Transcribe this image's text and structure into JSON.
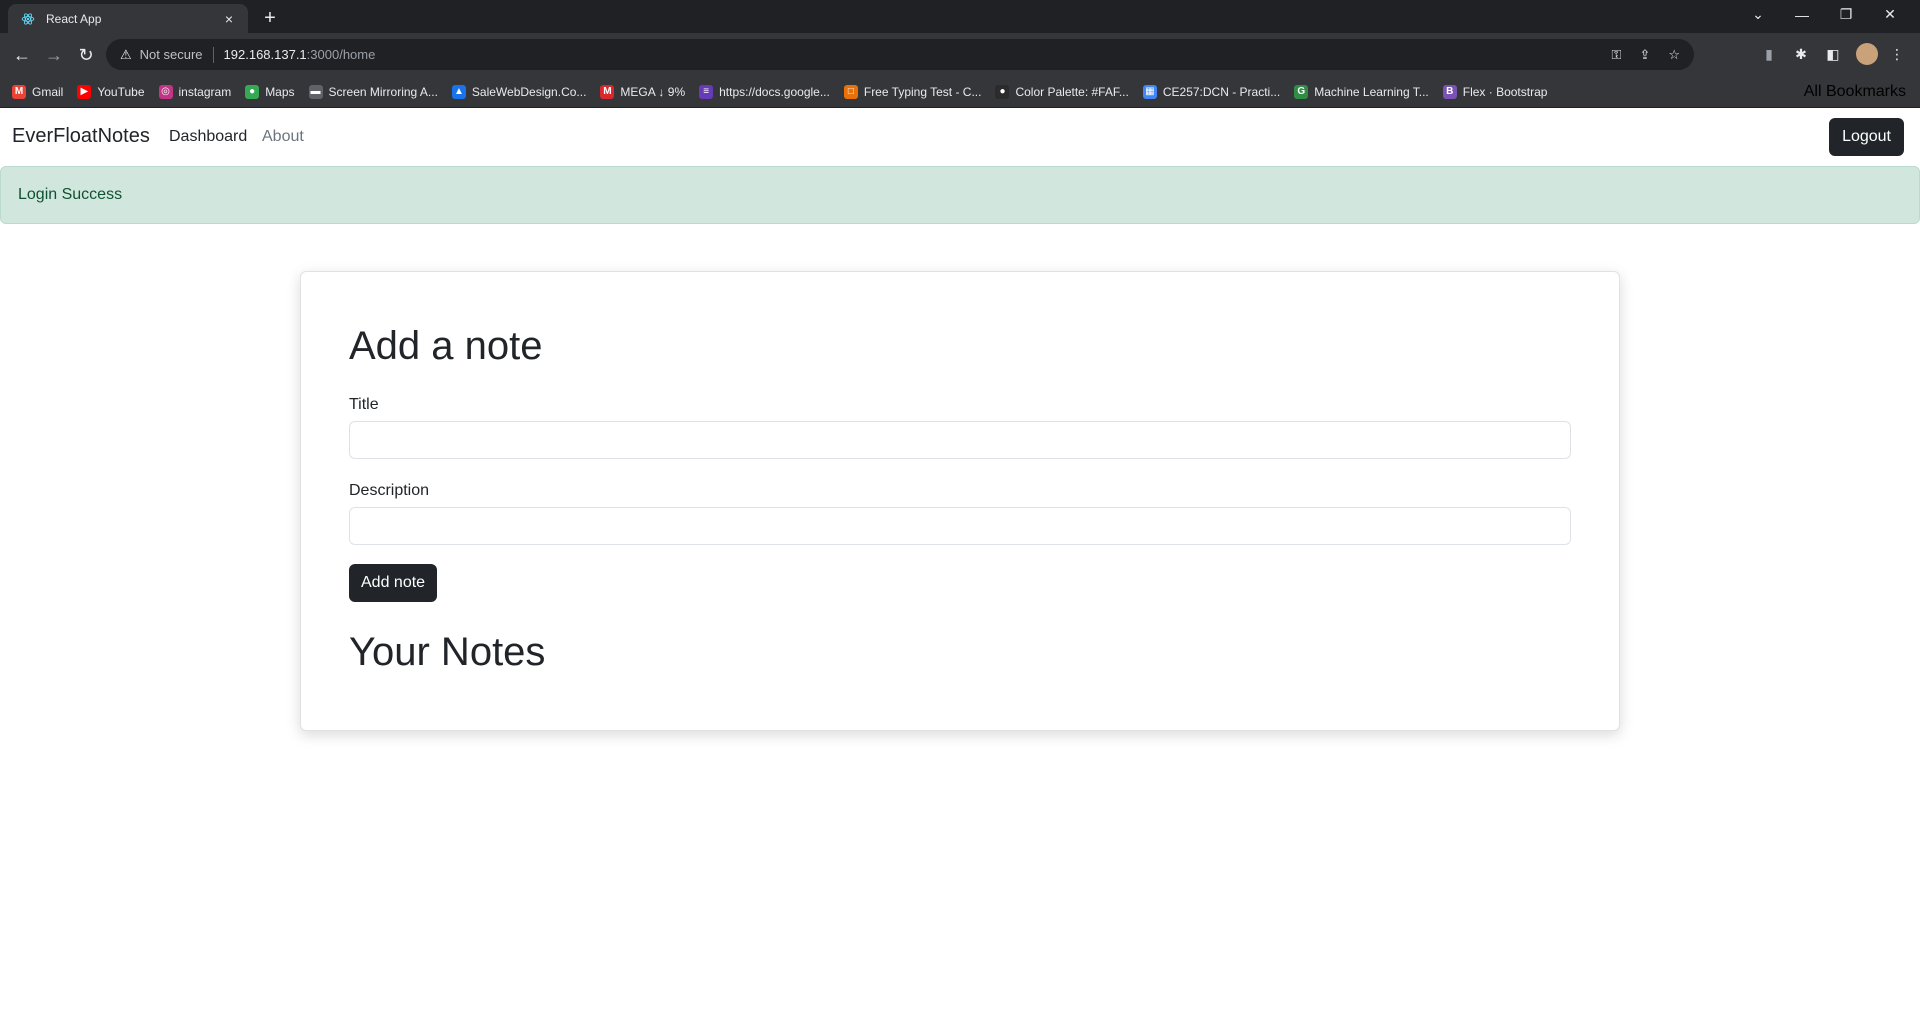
{
  "browser": {
    "tab_title": "React App",
    "tab_close": "×",
    "new_tab": "+",
    "window_controls": [
      "⌄",
      "—",
      "❐",
      "✕"
    ],
    "address": {
      "security_label": "Not secure",
      "host": "192.168.137.1",
      "path": ":3000/home"
    },
    "bookmarks": [
      {
        "label": "Gmail",
        "icon": "gmail-icon",
        "color": "#ea4335",
        "glyph": "M"
      },
      {
        "label": "YouTube",
        "icon": "youtube-icon",
        "color": "#ff0000",
        "glyph": "▶"
      },
      {
        "label": "instagram",
        "icon": "instagram-icon",
        "color": "#c13584",
        "glyph": "◎"
      },
      {
        "label": "Maps",
        "icon": "maps-icon",
        "color": "#34a853",
        "glyph": "●"
      },
      {
        "label": "Screen Mirroring A...",
        "icon": "screen-mirroring-icon",
        "color": "#5f6368",
        "glyph": "▬"
      },
      {
        "label": "SaleWebDesign.Co...",
        "icon": "drive-icon",
        "color": "#1a73e8",
        "glyph": "▲"
      },
      {
        "label": "MEGA ↓ 9%",
        "icon": "mega-icon",
        "color": "#d9272e",
        "glyph": "M"
      },
      {
        "label": "https://docs.google...",
        "icon": "google-forms-icon",
        "color": "#673ab7",
        "glyph": "≡"
      },
      {
        "label": "Free Typing Test - C...",
        "icon": "typing-test-icon",
        "color": "#e8710a",
        "glyph": "□"
      },
      {
        "label": "Color Palette: #FAF...",
        "icon": "color-palette-icon",
        "color": "#2b2b2b",
        "glyph": "●"
      },
      {
        "label": "CE257:DCN - Practi...",
        "icon": "classroom-icon",
        "color": "#4285f4",
        "glyph": "▦"
      },
      {
        "label": "Machine Learning T...",
        "icon": "geeksforgeeks-icon",
        "color": "#2f8d46",
        "glyph": "G"
      },
      {
        "label": "Flex · Bootstrap",
        "icon": "bootstrap-icon",
        "color": "#7952b3",
        "glyph": "B"
      }
    ],
    "all_bookmarks": "All Bookmarks"
  },
  "app": {
    "brand": "EverFloatNotes",
    "nav": {
      "dashboard": "Dashboard",
      "about": "About"
    },
    "logout_label": "Logout",
    "alert_text": "Login Success",
    "form": {
      "heading": "Add a note",
      "title_label": "Title",
      "title_value": "",
      "description_label": "Description",
      "description_value": "",
      "submit_label": "Add note"
    },
    "notes_heading": "Your Notes"
  },
  "colors": {
    "chrome_dark": "#202124",
    "chrome_mid": "#35363a",
    "primary_dark": "#212529",
    "alert_bg": "#d1e7dd",
    "alert_text": "#0f5132"
  }
}
